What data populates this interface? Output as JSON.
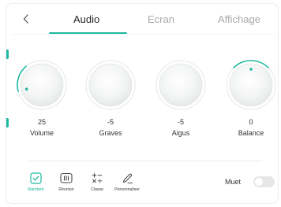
{
  "tabs": [
    {
      "label": "Audio",
      "active": true
    },
    {
      "label": "Ecran",
      "active": false
    },
    {
      "label": "Affichage",
      "active": false
    }
  ],
  "back_icon": "chevron-left-icon",
  "knobs": [
    {
      "value": "25",
      "label": "Volume",
      "level": 0.25
    },
    {
      "value": "-5",
      "label": "Graves",
      "level": 0.45
    },
    {
      "value": "-5",
      "label": "Aigus",
      "level": 0.45
    },
    {
      "value": "0",
      "label": "Balance",
      "level": 0.5
    }
  ],
  "presets": [
    {
      "label": "Standard",
      "icon": "check-square-icon",
      "active": true
    },
    {
      "label": "Réunion",
      "icon": "presentation-icon",
      "active": false
    },
    {
      "label": "Classe",
      "icon": "math-symbols-icon",
      "active": false
    },
    {
      "label": "Personnaliser",
      "icon": "edit-pen-icon",
      "active": false
    }
  ],
  "mute": {
    "label": "Muet",
    "on": false
  },
  "colors": {
    "accent": "#1fb8a0",
    "inactive_text": "#a8a8a8"
  }
}
